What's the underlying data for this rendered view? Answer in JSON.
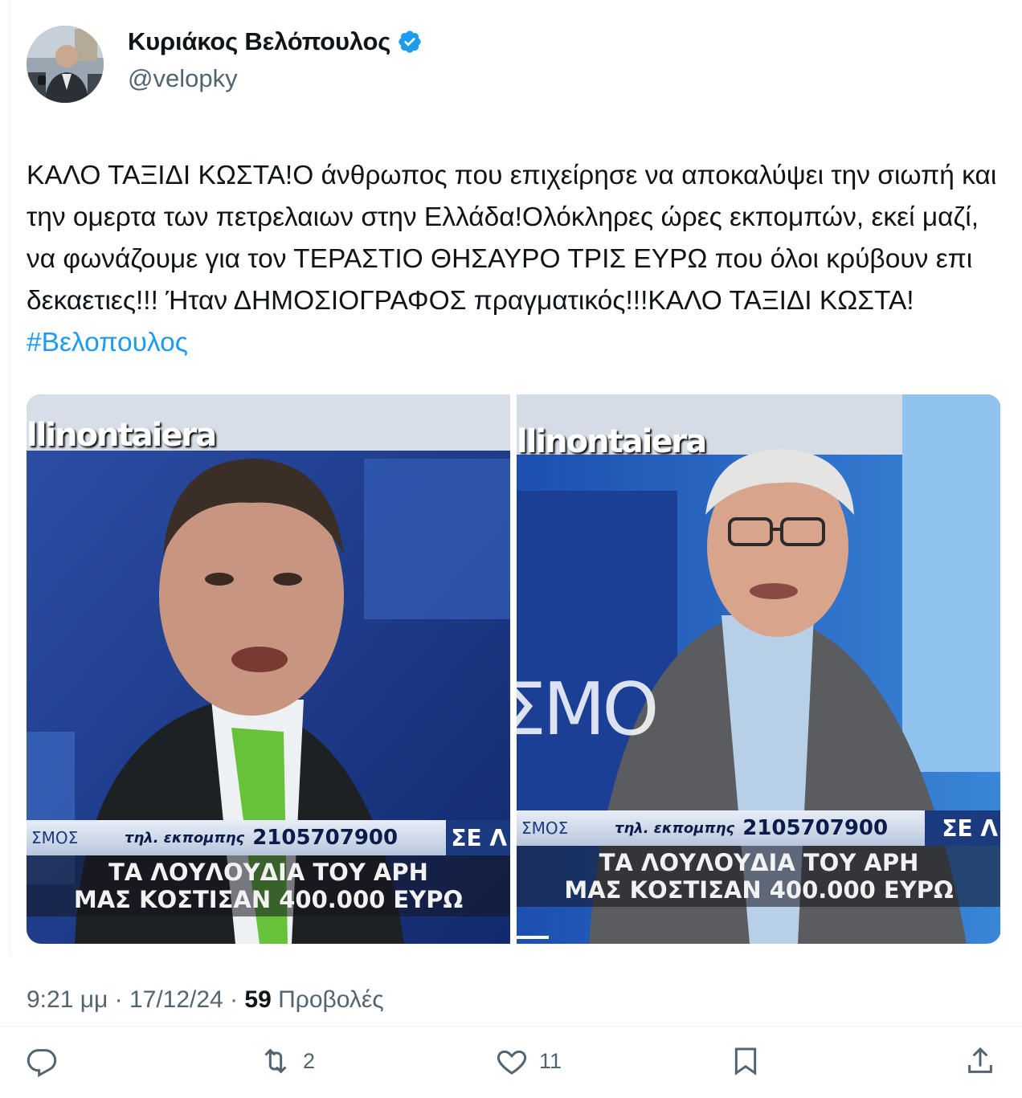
{
  "author": {
    "name": "Κυριάκος Βελόπουλος",
    "handle": "@velopky",
    "verified": true,
    "verified_color": "#1d9bf0"
  },
  "tweet": {
    "text": "ΚΑΛΟ ΤΑΞΙΔΙ ΚΩΣΤΑ!Ο άνθρωπος που επιχείρησε να αποκαλύψει την σιωπή και την ομερτα των πετρελαιων στην Ελλάδα!Ολόκληρες ώρες εκπομπών, εκεί μαζί, να φωνάζουμε για τον ΤΕΡΑΣΤΙΟ ΘΗΣΑΥΡΟ ΤΡΙΣ ΕΥΡΩ που όλοι κρύβουν επι δεκαετιες!!!  Ήταν ΔΗΜΟΣΙΟΓΡΑΦΟΣ πραγματικός!!!ΚΑΛΟ ΤΑΞΙΔΙ ΚΩΣΤΑ! ",
    "hashtag": "#Βελοπουλος"
  },
  "media": [
    {
      "channel": "llinontaiera",
      "ticker_left": "ΣΜΟΣ",
      "ticker_phone_label": "τηλ. εκπομπης",
      "ticker_phone": "2105707900",
      "ticker_right": "ΣΕ Λ",
      "caption_line1": "ΤΑ ΛΟΥΛΟΥΔΙΑ ΤΟΥ ΑΡΗ",
      "caption_line2": "ΜΑΣ ΚΟΣΤΙΣΑΝ 400.000 ΕΥΡΩ"
    },
    {
      "channel": "llinontaiera",
      "ticker_left": "ΣΜΟΣ",
      "ticker_phone_label": "τηλ. εκπομπης",
      "ticker_phone": "2105707900",
      "ticker_right": "ΣΕ Λ",
      "caption_line1": "ΤΑ ΛΟΥΛΟΥΔΙΑ ΤΟΥ ΑΡΗ",
      "caption_line2": "ΜΑΣ ΚΟΣΤΙΣΑΝ 400.000 ΕΥΡΩ",
      "backdrop_text": "ΣΜΟ"
    }
  ],
  "meta": {
    "time": "9:21 μμ",
    "sep1": " · ",
    "date": "17/12/24",
    "sep2": " · ",
    "views_count": "59",
    "views_label": " Προβολές"
  },
  "actions": {
    "reply_icon": "reply-icon",
    "retweet_icon": "retweet-icon",
    "retweet_count": "2",
    "like_icon": "heart-icon",
    "like_count": "11",
    "bookmark_icon": "bookmark-icon",
    "share_icon": "share-icon"
  }
}
